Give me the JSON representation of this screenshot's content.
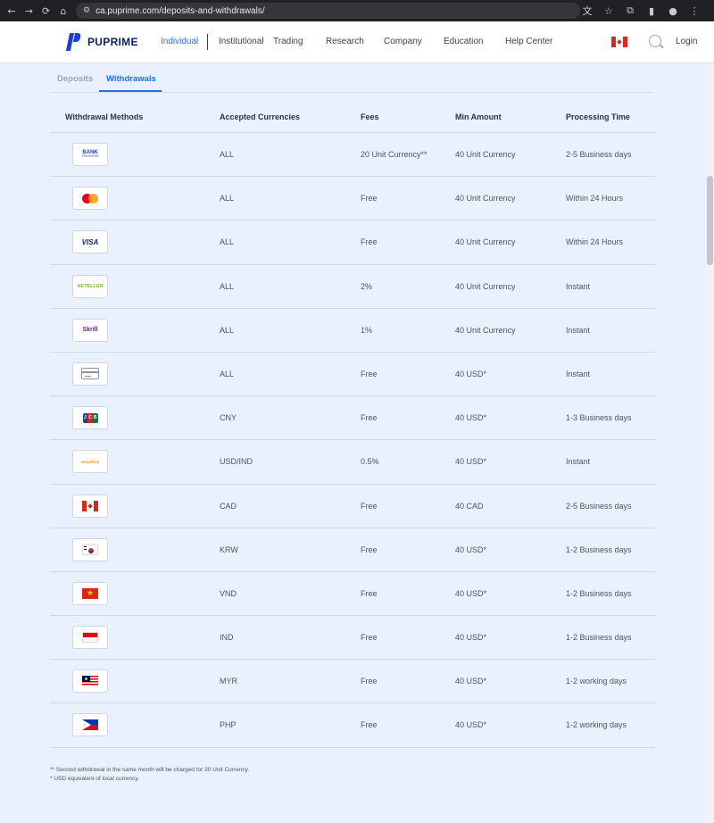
{
  "browser": {
    "url": "ca.puprime.com/deposits-and-withdrawals/",
    "nav_glyphs": {
      "back": "←",
      "forward": "→",
      "reload": "⟳",
      "home": "⌂",
      "site_info": "⚙"
    },
    "action_glyphs": {
      "translate": "文",
      "bookmark": "☆",
      "extensions": "⧉",
      "sidebar": "▮",
      "profile": "●",
      "menu": "⋮"
    }
  },
  "header": {
    "logo_text": "PUPRIME",
    "nav_items": [
      "Individual",
      "Institutional",
      "Trading",
      "Research",
      "Company",
      "Education",
      "Help Center"
    ],
    "active_nav": "Individual",
    "login_label": "Login"
  },
  "tabs": [
    "Deposits",
    "Withdrawals"
  ],
  "active_tab": "Withdrawals",
  "table": {
    "columns": [
      "Withdrawal Methods",
      "Accepted Currencies",
      "Fees",
      "Min Amount",
      "Processing Time"
    ],
    "rows": [
      {
        "method_icon": "bank-transfer-logo",
        "currency": "ALL",
        "fee": "20 Unit Currency**",
        "min": "40 Unit Currency",
        "time": "2-5 Business days"
      },
      {
        "method_icon": "mastercard-logo",
        "currency": "ALL",
        "fee": "Free",
        "min": "40 Unit Currency",
        "time": "Within 24 Hours"
      },
      {
        "method_icon": "visa-logo",
        "currency": "ALL",
        "fee": "Free",
        "min": "40 Unit Currency",
        "time": "Within 24 Hours"
      },
      {
        "method_icon": "neteller-logo",
        "currency": "ALL",
        "fee": "2%",
        "min": "40 Unit Currency",
        "time": "Instant"
      },
      {
        "method_icon": "skrill-logo",
        "currency": "ALL",
        "fee": "1%",
        "min": "40 Unit Currency",
        "time": "Instant"
      },
      {
        "method_icon": "credit-card-icon",
        "currency": "ALL",
        "fee": "Free",
        "min": "40 USD*",
        "time": "Instant"
      },
      {
        "method_icon": "jcb-logo",
        "currency": "CNY",
        "fee": "Free",
        "min": "40 USD*",
        "time": "1-3 Business days"
      },
      {
        "method_icon": "help2pay-logo",
        "currency": "USD/IND",
        "fee": "0.5%",
        "min": "40 USD*",
        "time": "Instant"
      },
      {
        "method_icon": "canada-flag",
        "currency": "CAD",
        "fee": "Free",
        "min": "40 CAD",
        "time": "2-5 Business days"
      },
      {
        "method_icon": "korea-flag",
        "currency": "KRW",
        "fee": "Free",
        "min": "40 USD*",
        "time": "1-2 Business days"
      },
      {
        "method_icon": "vietnam-flag",
        "currency": "VND",
        "fee": "Free",
        "min": "40 USD*",
        "time": "1-2 Business days"
      },
      {
        "method_icon": "indonesia-flag",
        "currency": "IND",
        "fee": "Free",
        "min": "40 USD*",
        "time": "1-2 Business days"
      },
      {
        "method_icon": "malaysia-flag",
        "currency": "MYR",
        "fee": "Free",
        "min": "40 USD*",
        "time": "1-2 working days"
      },
      {
        "method_icon": "philippines-flag",
        "currency": "PHP",
        "fee": "Free",
        "min": "40 USD*",
        "time": "1-2 working days"
      }
    ]
  },
  "icon_text": {
    "bank": "BANK",
    "bank_sub": "TRANSFER",
    "visa": "VISA",
    "neteller": "NETELLER",
    "skrill": "Skrill",
    "jcb": [
      "J",
      "C",
      "B"
    ],
    "help2pay": "Help2Pay"
  },
  "notes": [
    "** Second withdrawal in the same month will be charged for 20 Unit Currency.",
    "* USD equivalent of local currency."
  ],
  "colors": {
    "accent": "#1f6fe5",
    "page_bg": "#e8f1fd",
    "logo_navy": "#0c1e63"
  }
}
